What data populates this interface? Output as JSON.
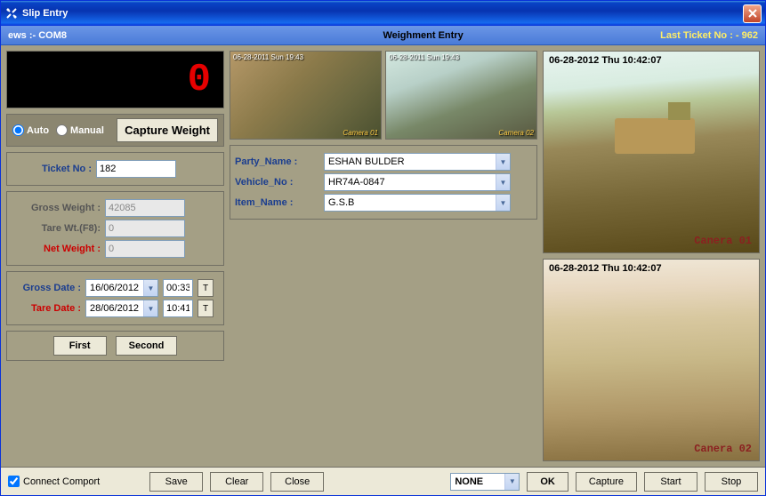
{
  "window": {
    "title": "Slip Entry"
  },
  "subheader": {
    "left": "ews :- COM8",
    "center": "Weighment Entry",
    "right": "Last Ticket No : - 962"
  },
  "led": {
    "value": "0"
  },
  "mode": {
    "auto": "Auto",
    "manual": "Manual",
    "capture": "Capture Weight"
  },
  "ticket": {
    "label": "Ticket No :",
    "value": "182"
  },
  "weights": {
    "gross_label": "Gross Weight :",
    "gross_value": "42085",
    "tare_label": "Tare Wt.(F8):",
    "tare_value": "0",
    "net_label": "Net Weight :",
    "net_value": "0"
  },
  "dates": {
    "gross_label": "Gross Date :",
    "gross_date": "16/06/2012",
    "gross_time": "00:33",
    "tare_label": "Tare Date :",
    "tare_date": "28/06/2012",
    "tare_time": "10:41",
    "t": "T"
  },
  "buttons": {
    "first": "First",
    "second": "Second"
  },
  "party": {
    "party_label": "Party_Name :",
    "party_value": "ESHAN BULDER",
    "vehicle_label": "Vehicle_No :",
    "vehicle_value": "HR74A-0847",
    "item_label": "Item_Name :",
    "item_value": "G.S.B"
  },
  "thumbs": {
    "t1_ts": "06-28-2011 Sun 19:43",
    "t1_lbl": "Camera 01",
    "t2_ts": "06-28-2011 Sun 19:43",
    "t2_lbl": "Camera 02"
  },
  "cams": {
    "c1_ts": "06-28-2012 Thu 10:42:07",
    "c1_lbl": "Canera 01",
    "c2_ts": "06-28-2012 Thu 10:42:07",
    "c2_lbl": "Canera 02"
  },
  "footer": {
    "connect": "Connect Comport",
    "save": "Save",
    "clear": "Clear",
    "close": "Close",
    "none": "NONE",
    "ok": "OK",
    "capture": "Capture",
    "start": "Start",
    "stop": "Stop"
  }
}
